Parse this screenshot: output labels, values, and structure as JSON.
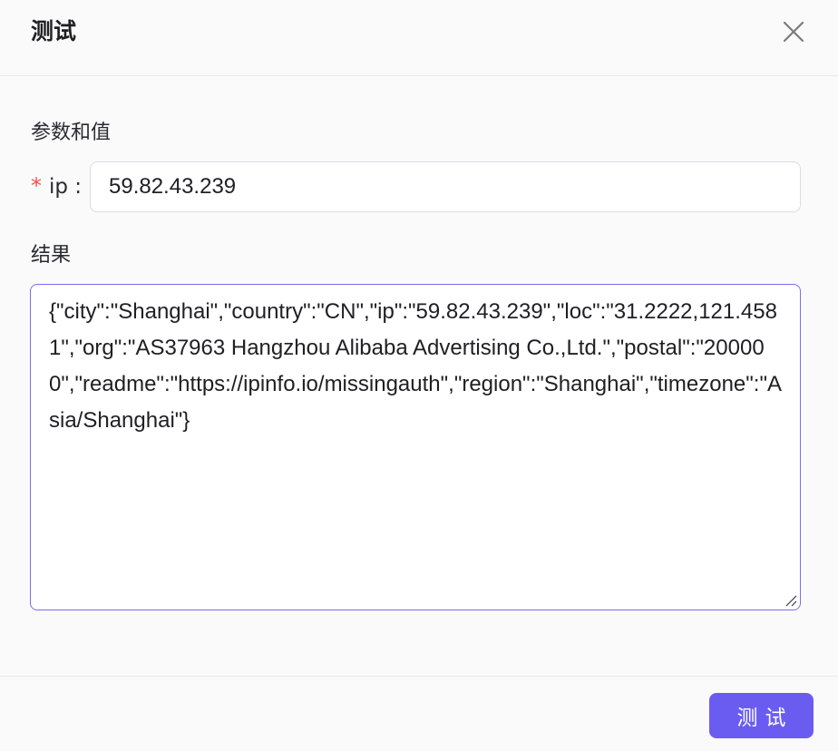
{
  "dialog": {
    "title": "测试",
    "close_icon": "close-icon"
  },
  "params": {
    "section_label": "参数和值",
    "fields": [
      {
        "required_mark": "*",
        "label": "ip :",
        "value": "59.82.43.239"
      }
    ]
  },
  "result": {
    "section_label": "结果",
    "value": "{\"city\":\"Shanghai\",\"country\":\"CN\",\"ip\":\"59.82.43.239\",\"loc\":\"31.2222,121.4581\",\"org\":\"AS37963 Hangzhou Alibaba Advertising Co.,Ltd.\",\"postal\":\"200000\",\"readme\":\"https://ipinfo.io/missingauth\",\"region\":\"Shanghai\",\"timezone\":\"Asia/Shanghai\"}"
  },
  "footer": {
    "test_button_label": "测试"
  },
  "colors": {
    "accent": "#6a5cf0",
    "required": "#ff4d4f",
    "result_border": "#7a6cf0"
  }
}
